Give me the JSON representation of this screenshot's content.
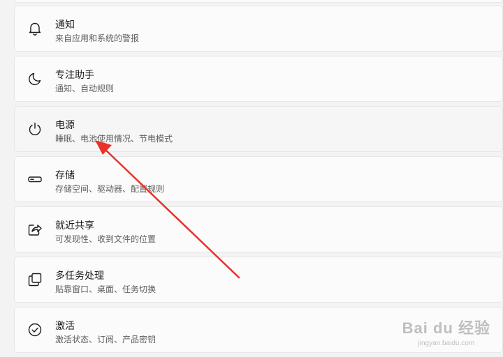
{
  "settings": {
    "items": [
      {
        "title": "通知",
        "desc": "来自应用和系统的警报",
        "icon": "bell-icon"
      },
      {
        "title": "专注助手",
        "desc": "通知、自动规则",
        "icon": "moon-icon"
      },
      {
        "title": "电源",
        "desc": "睡眠、电池使用情况、节电模式",
        "icon": "power-icon"
      },
      {
        "title": "存储",
        "desc": "存储空间、驱动器、配置规则",
        "icon": "storage-drive-icon"
      },
      {
        "title": "就近共享",
        "desc": "可发现性、收到文件的位置",
        "icon": "share-icon"
      },
      {
        "title": "多任务处理",
        "desc": "贴靠窗口、桌面、任务切换",
        "icon": "multitasking-icon"
      },
      {
        "title": "激活",
        "desc": "激活状态、订阅、产品密钥",
        "icon": "checkmark-circle-icon"
      }
    ]
  },
  "watermark": {
    "main": "Bai du 经验",
    "sub": "jingyan.baidu.com"
  }
}
